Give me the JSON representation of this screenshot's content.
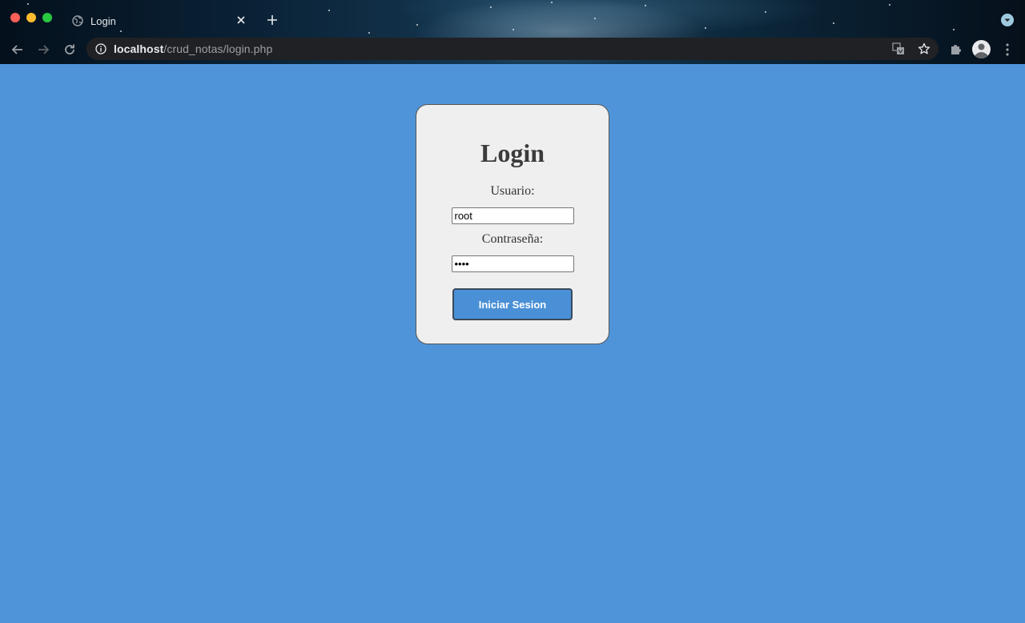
{
  "browser": {
    "tab_title": "Login",
    "url_host": "localhost",
    "url_path": "/crud_notas/login.php"
  },
  "page": {
    "title": "Login",
    "username_label": "Usuario:",
    "username_value": "root",
    "password_label": "Contraseña:",
    "password_value": "••••",
    "submit_label": "Iniciar Sesion"
  },
  "colors": {
    "page_background": "#4f94d8",
    "card_background": "#efefef",
    "button_background": "#4a90d6"
  },
  "icons": [
    "globe-icon",
    "close-icon",
    "plus-icon",
    "tab-search-icon",
    "back-arrow-icon",
    "forward-arrow-icon",
    "reload-icon",
    "info-icon",
    "translate-icon",
    "star-icon",
    "puzzle-icon",
    "profile-icon",
    "kebab-menu-icon"
  ]
}
